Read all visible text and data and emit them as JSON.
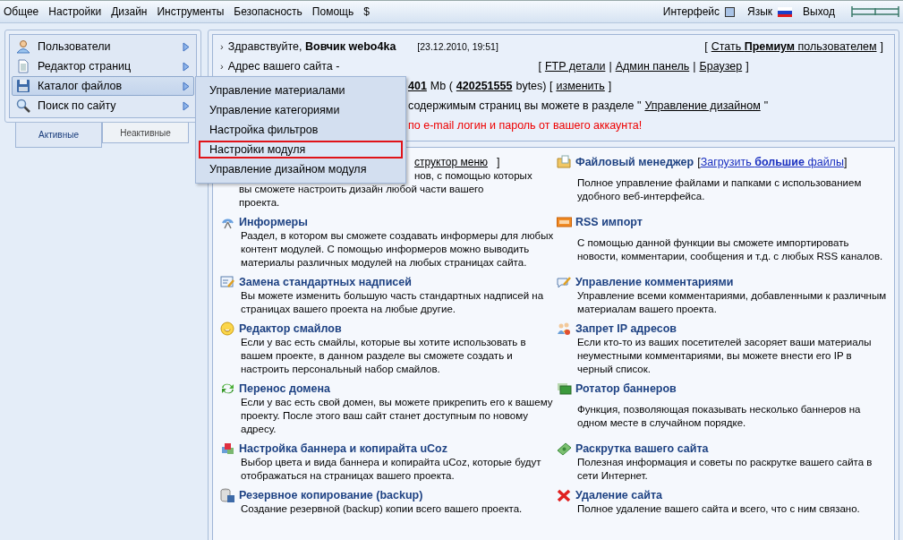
{
  "topbar": {
    "menu": [
      "Общее",
      "Настройки",
      "Дизайн",
      "Инструменты",
      "Безопасность",
      "Помощь",
      "$"
    ],
    "interface_label": "Интерфейс",
    "language_label": "Язык",
    "logout": "Выход"
  },
  "sidebar": {
    "items": [
      {
        "label": "Пользователи",
        "selected": false
      },
      {
        "label": "Редактор страниц",
        "selected": false
      },
      {
        "label": "Каталог файлов",
        "selected": true
      },
      {
        "label": "Поиск по сайту",
        "selected": false
      }
    ],
    "tabs": [
      {
        "label": "Активные",
        "selected": true
      },
      {
        "label": "Неактивные",
        "selected": false
      }
    ]
  },
  "submenu": {
    "items": [
      {
        "label": "Управление материалами",
        "highlighted": false
      },
      {
        "label": "Управление категориями",
        "highlighted": false
      },
      {
        "label": "Настройка фильтров",
        "highlighted": false
      },
      {
        "label": "Настройки модуля",
        "highlighted": true
      },
      {
        "label": "Управление дизайном модуля",
        "highlighted": false
      }
    ]
  },
  "info": {
    "lines": [
      {
        "bullet": "›",
        "covered": false,
        "left": [
          {
            "kind": "text",
            "text": "Здравствуйте, **Вовчик webo4ka**"
          },
          {
            "kind": "date",
            "text": "[23.12.2010, 19:51]"
          }
        ],
        "right": [
          {
            "kind": "text",
            "text": "["
          },
          {
            "kind": "link",
            "text": "Стать **Премиум** пользователем"
          },
          {
            "kind": "text",
            "text": "]"
          }
        ]
      },
      {
        "bullet": "›",
        "covered": false,
        "left": [
          {
            "kind": "text",
            "text": "Адрес вашего сайта -"
          },
          {
            "kind": "gap",
            "text": "["
          },
          {
            "kind": "link",
            "text": "FTP детали"
          },
          {
            "kind": "text",
            "text": "|"
          },
          {
            "kind": "link",
            "text": "Админ панель"
          },
          {
            "kind": "text",
            "text": "|"
          },
          {
            "kind": "link",
            "text": "Браузер"
          },
          {
            "kind": "text",
            "text": "]"
          }
        ]
      },
      {
        "covered": true,
        "left": [
          {
            "kind": "strong-link",
            "text": "401"
          },
          {
            "kind": "text",
            "text": "Mb ("
          },
          {
            "kind": "strong-link",
            "text": "420251555"
          },
          {
            "kind": "text",
            "text": "bytes) ["
          },
          {
            "kind": "link",
            "text": "изменить"
          },
          {
            "kind": "text",
            "text": "]"
          }
        ]
      },
      {
        "covered": true,
        "left": [
          {
            "kind": "text",
            "text": "содержимым страниц вы можете в разделе \""
          },
          {
            "kind": "link",
            "text": "Управление дизайном"
          },
          {
            "kind": "text",
            "text": "\""
          }
        ]
      },
      {
        "covered": true,
        "left": [
          {
            "kind": "warning",
            "text": "по e-mail логин и пароль от вашего аккаунта!"
          }
        ]
      }
    ]
  },
  "features": [
    {
      "kind": "partial",
      "title_fragment": "структор меню",
      "title_close": "]",
      "lines": [
        "нов, с помощью которых",
        "вы сможете настроить дизайн любой части вашего",
        "проекта."
      ]
    },
    {
      "kind": "full",
      "title": "Файловый менеджер",
      "link_open": "[",
      "link": "Загрузить **большие** файлы",
      "link_close": "]",
      "desc": "Полное управление файлами и папками с использованием удобного веб-интерфейса."
    },
    {
      "kind": "full",
      "title": "Информеры",
      "desc": "Раздел, в котором вы сможете создавать информеры для любых контент модулей. С помощью информеров можно выводить материалы различных модулей на любых страницах сайта."
    },
    {
      "kind": "full",
      "title": "RSS импорт",
      "desc": "С помощью данной функции вы сможете импортировать новости, комментарии, сообщения и т.д. с любых RSS каналов."
    },
    {
      "kind": "full",
      "title": "Замена стандартных надписей",
      "desc": "Вы можете изменить большую часть стандартных надписей на страницах вашего проекта на любые другие."
    },
    {
      "kind": "full",
      "title": "Управление комментариями",
      "desc": "Управление всеми комментариями, добавленными к различным материалам вашего проекта."
    },
    {
      "kind": "full",
      "title": "Редактор смайлов",
      "desc": "Если у вас есть смайлы, которые вы хотите использовать в вашем проекте, в данном разделе вы сможете создать и настроить персональный набор смайлов."
    },
    {
      "kind": "full",
      "title": "Запрет IP адресов",
      "desc": "Если кто-то из ваших посетителей засоряет ваши материалы неуместными комментариями, вы можете внести его IP в черный список."
    },
    {
      "kind": "full",
      "title": "Перенос домена",
      "desc": "Если у вас есть свой домен, вы можете прикрепить его к вашему проекту. После этого ваш сайт станет доступным по новому адресу."
    },
    {
      "kind": "full",
      "title": "Ротатор баннеров",
      "desc": "Функция, позволяющая показывать несколько баннеров на одном месте в случайном порядке."
    },
    {
      "kind": "full",
      "title": "Настройка баннера и копирайта uCoz",
      "desc": "Выбор цвета и вида баннера и копирайта uCoz, которые будут отображаться на страницах вашего проекта."
    },
    {
      "kind": "full",
      "title": "Раскрутка вашего сайта",
      "desc": "Полезная информация и советы по раскрутке вашего сайта в сети Интернет."
    },
    {
      "kind": "full",
      "title": "Резервное копирование (backup)",
      "desc": "Создание резервной (backup) копии всего вашего проекта."
    },
    {
      "kind": "full",
      "title": "Удаление сайта",
      "desc": "Полное удаление вашего сайта и всего, что с ним связано."
    }
  ]
}
